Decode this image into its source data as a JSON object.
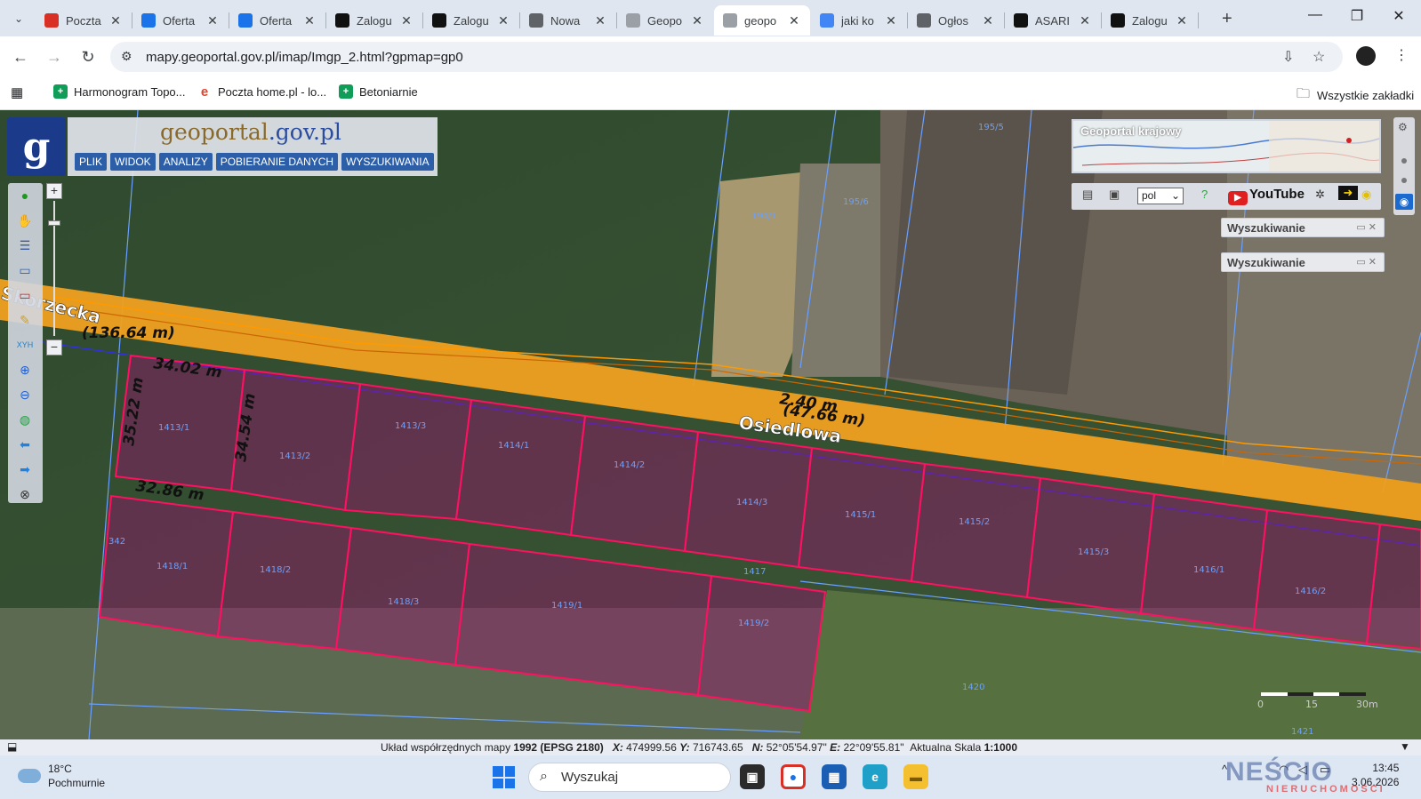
{
  "browser": {
    "tabs": [
      {
        "label": "Poczta",
        "icon": "gmail-icon",
        "color": "#d93025"
      },
      {
        "label": "Oferta",
        "icon": "search-icon",
        "color": "#1a73e8"
      },
      {
        "label": "Oferta",
        "icon": "search-icon",
        "color": "#1a73e8"
      },
      {
        "label": "Zalogu",
        "icon": "asari-icon",
        "color": "#111111"
      },
      {
        "label": "Zalogu",
        "icon": "asari-icon",
        "color": "#111111"
      },
      {
        "label": "Nowa",
        "icon": "chrome-icon",
        "color": "#5f6368"
      },
      {
        "label": "Geopo",
        "icon": "geoportal-icon",
        "color": "#9aa0a6"
      },
      {
        "label": "geopo",
        "icon": "geoportal-icon",
        "color": "#9aa0a6",
        "active": true
      },
      {
        "label": "jaki ko",
        "icon": "google-icon",
        "color": "#4285f4"
      },
      {
        "label": "Ogłos",
        "icon": "globe-icon",
        "color": "#5f6368"
      },
      {
        "label": "ASARI",
        "icon": "asari-icon",
        "color": "#111111"
      },
      {
        "label": "Zalogu",
        "icon": "asari-icon",
        "color": "#111111"
      }
    ],
    "url": "mapy.geoportal.gov.pl/imap/Imgp_2.html?gpmap=gp0",
    "bookmarks": [
      {
        "label": "Harmonogram Topo...",
        "icon": "sheets-icon",
        "color": "#0f9d58"
      },
      {
        "label": "Poczta home.pl - lo...",
        "icon": "home-pl-icon",
        "color": "#e8422a"
      },
      {
        "label": "Betoniarnie",
        "icon": "sheets-icon",
        "color": "#0f9d58"
      }
    ],
    "all_bookmarks": "Wszystkie zakładki"
  },
  "geoportal": {
    "logo_letter": "g",
    "brand_part1": "geoportal",
    "brand_part2": ".gov.pl",
    "menu": [
      "PLIK",
      "WIDOK",
      "ANALIZY",
      "POBIERANIE DANYCH",
      "WYSZUKIWANIA"
    ],
    "overview_title": "Geoportal krajowy",
    "language": "pol",
    "youtube_label": "YouTube",
    "search_panels": [
      "Wyszukiwanie",
      "Wyszukiwanie"
    ]
  },
  "map_labels": {
    "street_main": "Osiedlowa",
    "street_left": "Skorzecka",
    "measures": [
      {
        "text": "(136.64 m)"
      },
      {
        "text": "34.02 m"
      },
      {
        "text": "35.22 m"
      },
      {
        "text": "34.54 m"
      },
      {
        "text": "32.86 m"
      },
      {
        "text": "2.40 m"
      },
      {
        "text": "(47.66 m)"
      }
    ],
    "parcels": [
      "195/5",
      "194/1",
      "195/6",
      "1413/1",
      "1413/2",
      "1413/3",
      "1414/1",
      "1414/2",
      "1414/3",
      "1415/1",
      "1415/2",
      "1415/3",
      "1416/1",
      "1416/2",
      "342",
      "1418/1",
      "1418/2",
      "1418/3",
      "1419/1",
      "1419/2",
      "1417",
      "1420",
      "1421"
    ],
    "scale_ticks": [
      "0",
      "15",
      "30m"
    ]
  },
  "status": {
    "system_label": "Układ współrzędnych mapy",
    "system_value": "1992 (EPSG 2180)",
    "x_label": "X:",
    "x_value": "474999.56",
    "y_label": "Y:",
    "y_value": "716743.65",
    "n_label": "N:",
    "n_value": "52°05'54.97\"",
    "e_label": "E:",
    "e_value": "22°09'55.81\"",
    "scale_label": "Aktualna Skala",
    "scale_value": "1:1000"
  },
  "taskbar": {
    "temperature": "18°C",
    "weather": "Pochmurnie",
    "search_placeholder": "Wyszukaj",
    "time": "13:45",
    "date": "3.06.2026"
  },
  "watermark": {
    "brand": "NEŚCIO",
    "sub": "NIERUCHOMOŚCI"
  },
  "colors": {
    "parcel_outline": "#ff1060",
    "road": "#f0a020",
    "cadastral_line": "#6aa0ff",
    "parcel_fill": "rgba(150,20,110,0.45)"
  }
}
